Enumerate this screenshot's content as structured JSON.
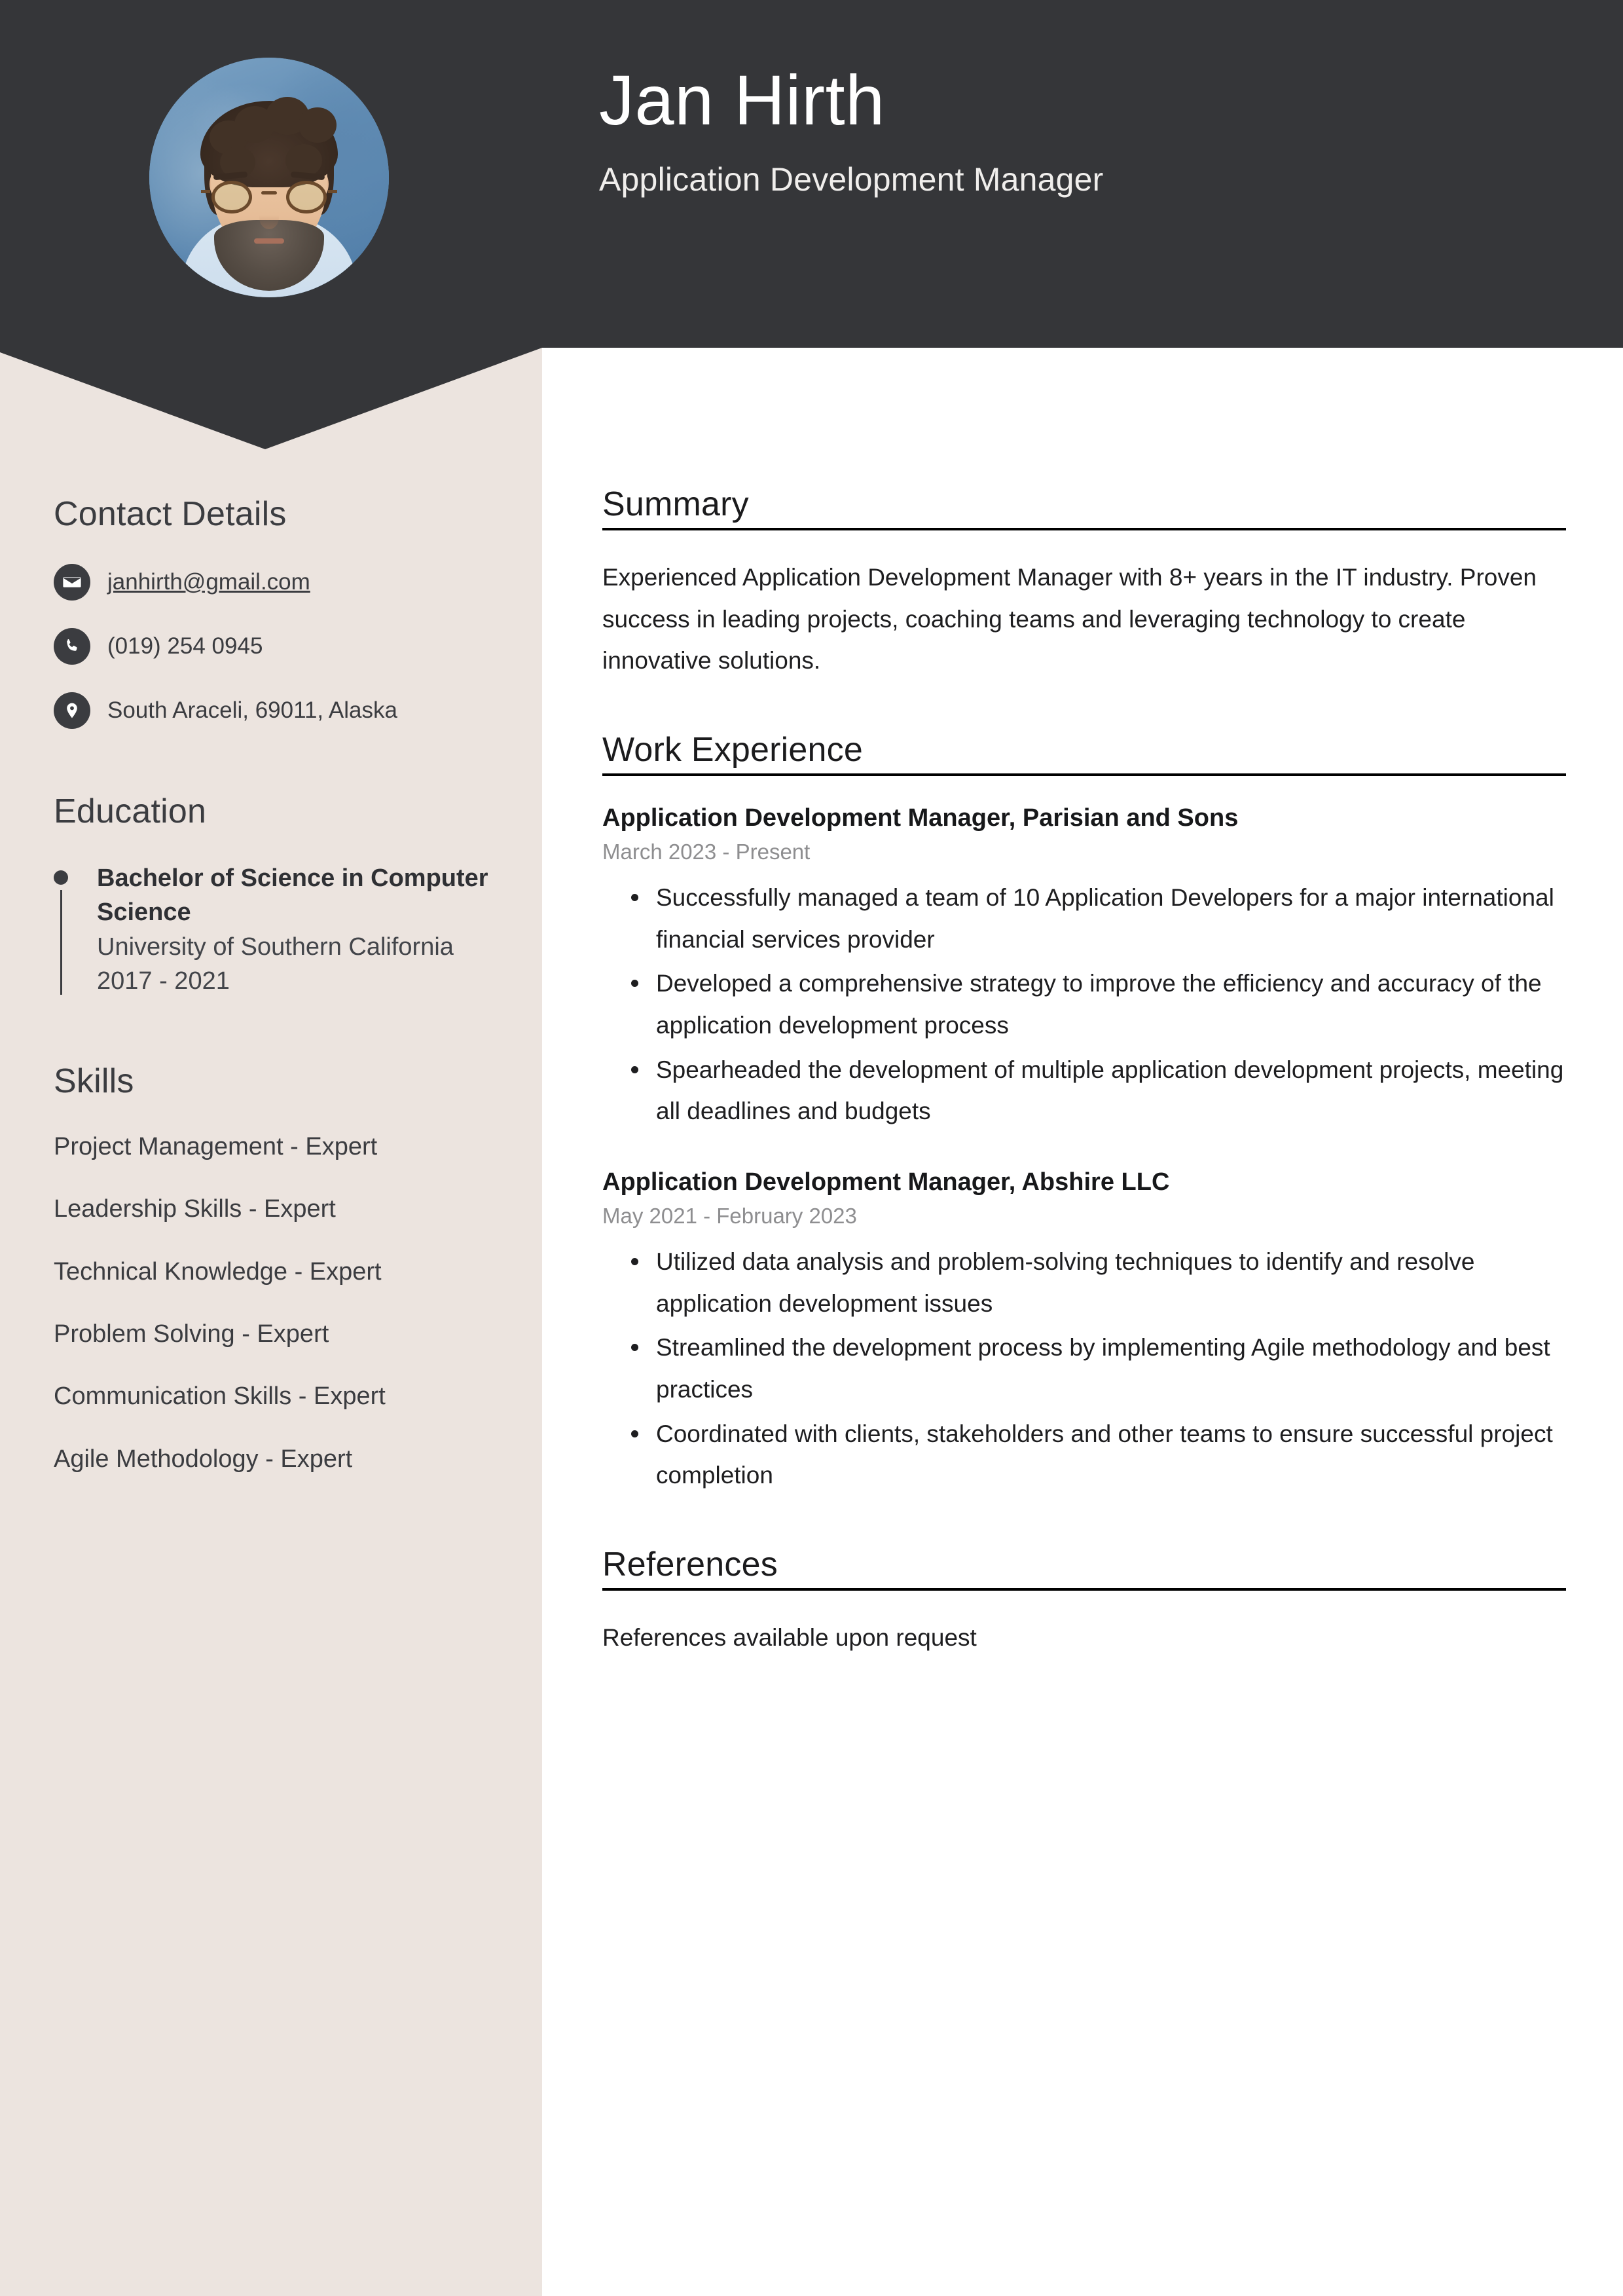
{
  "header": {
    "name": "Jan Hirth",
    "job_title": "Application Development Manager",
    "avatar_alt": "profile-photo",
    "background_color": "#353639"
  },
  "sidebar": {
    "background_color": "#ece4df",
    "contact": {
      "heading": "Contact Details",
      "items": [
        {
          "icon": "envelope-icon",
          "text": "janhirth@gmail.com",
          "is_link": true
        },
        {
          "icon": "phone-icon",
          "text": "(019) 254 0945",
          "is_link": false
        },
        {
          "icon": "location-pin-icon",
          "text": "South Araceli, 69011, Alaska",
          "is_link": false
        }
      ]
    },
    "education": {
      "heading": "Education",
      "items": [
        {
          "degree": "Bachelor of Science in Computer Science",
          "school": "University of Southern California",
          "years": "2017 - 2021"
        }
      ]
    },
    "skills": {
      "heading": "Skills",
      "items": [
        "Project Management - Expert",
        "Leadership Skills - Expert",
        "Technical Knowledge - Expert",
        "Problem Solving - Expert",
        "Communication Skills - Expert",
        "Agile Methodology - Expert"
      ]
    }
  },
  "main": {
    "summary": {
      "heading": "Summary",
      "text": "Experienced Application Development Manager with 8+ years in the IT industry. Proven success in leading projects, coaching teams and leveraging technology to create innovative solutions."
    },
    "work_experience": {
      "heading": "Work Experience",
      "jobs": [
        {
          "title": "Application Development Manager, Parisian and Sons",
          "dates": "March 2023 - Present",
          "bullets": [
            "Successfully managed a team of 10 Application Developers for a major international financial services provider",
            "Developed a comprehensive strategy to improve the efficiency and accuracy of the application development process",
            "Spearheaded the development of multiple application development projects, meeting all deadlines and budgets"
          ]
        },
        {
          "title": "Application Development Manager, Abshire LLC",
          "dates": "May 2021 - February 2023",
          "bullets": [
            "Utilized data analysis and problem-solving techniques to identify and resolve application development issues",
            "Streamlined the development process by implementing Agile methodology and best practices",
            "Coordinated with clients, stakeholders and other teams to ensure successful project completion"
          ]
        }
      ]
    },
    "references": {
      "heading": "References",
      "text": "References available upon request"
    }
  }
}
